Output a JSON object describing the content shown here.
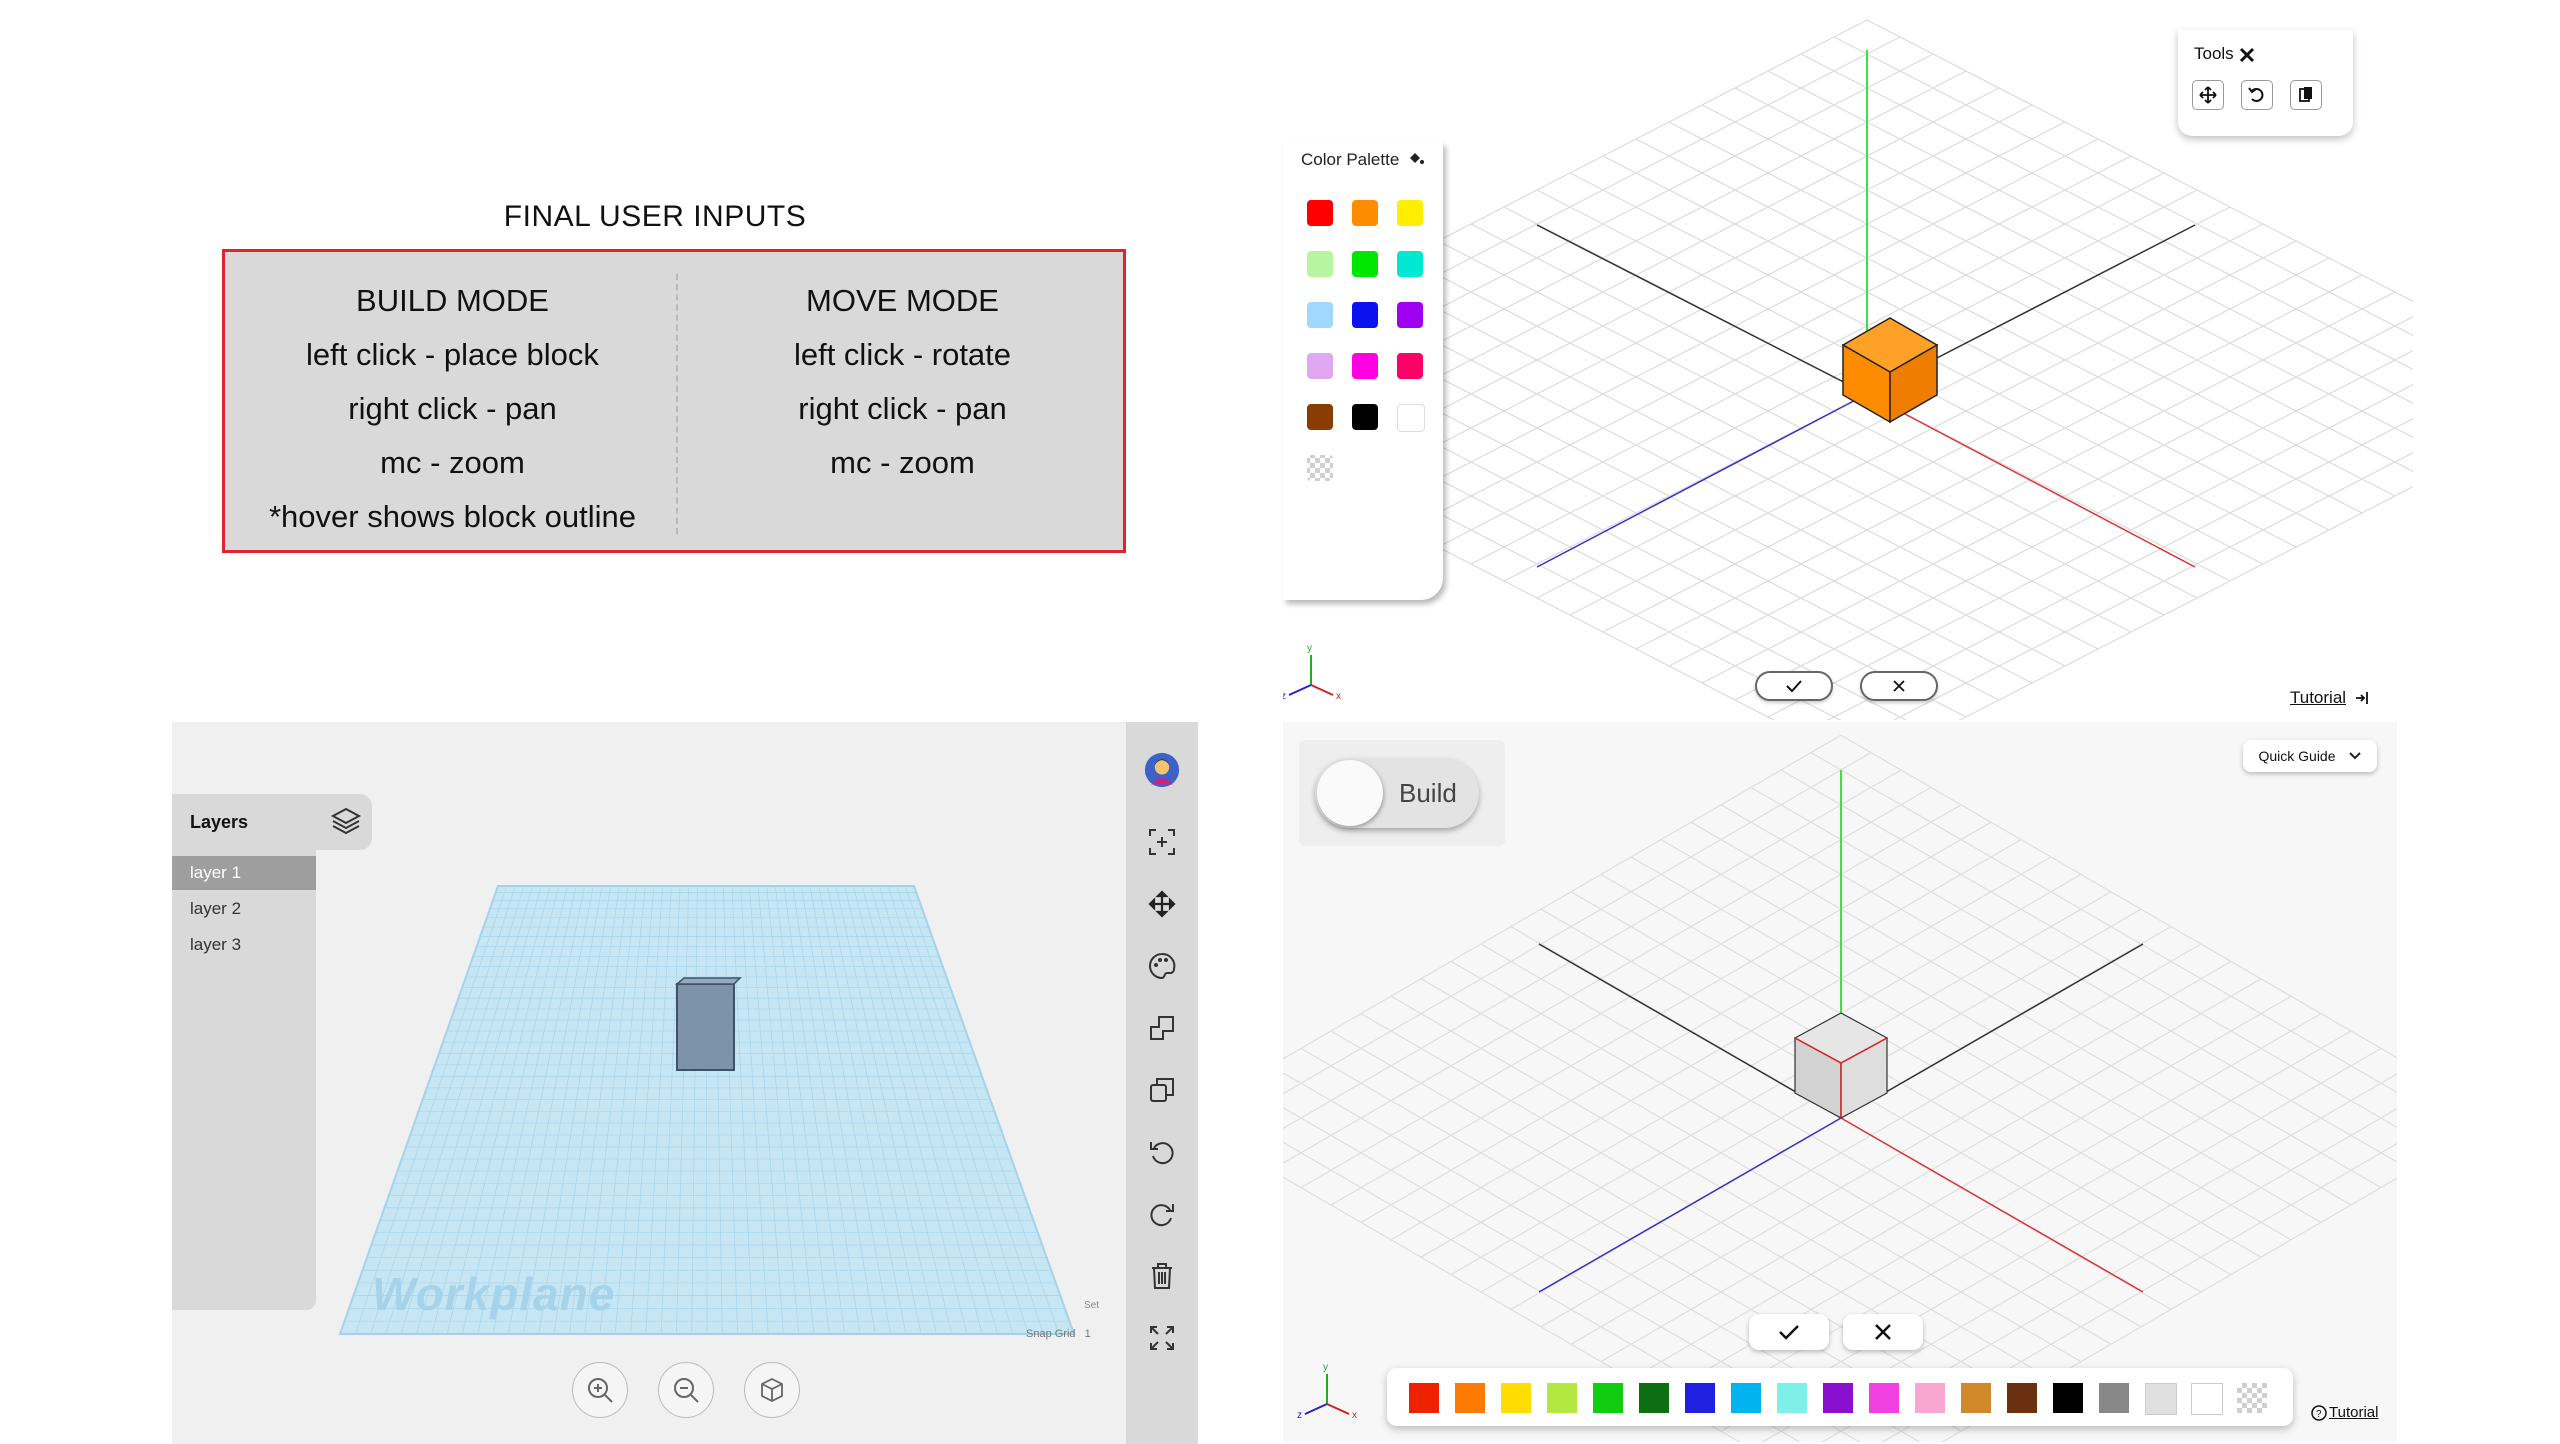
{
  "inputs": {
    "title": "FINAL USER INPUTS",
    "build_mode": {
      "heading": "BUILD MODE",
      "lines": [
        "left click - place block",
        "right click - pan",
        "mc - zoom",
        "*hover shows block outline"
      ]
    },
    "move_mode": {
      "heading": "MOVE MODE",
      "lines": [
        "left click - rotate",
        "right click - pan",
        "mc - zoom"
      ]
    }
  },
  "palette_scene": {
    "palette_title": "Color Palette",
    "palette_icon": "paint-bucket-icon",
    "swatches": [
      "#ff0000",
      "#ff8c00",
      "#ffee00",
      "#b8f5a0",
      "#00e600",
      "#00e8d0",
      "#a0d8ff",
      "#0a12f0",
      "#a000f0",
      "#e0a8f0",
      "#ff00e0",
      "#ff0066",
      "#8a3d00",
      "#000000",
      "#ffffff",
      "transparent"
    ],
    "tools_title": "Tools",
    "tools_icon": "crossed-tools-icon",
    "tools": [
      "move-icon",
      "rotate-icon",
      "copy-icon"
    ],
    "confirm_icon": "check-icon",
    "cancel_icon": "close-icon",
    "tutorial_label": "Tutorial",
    "tutorial_icon": "exit-icon",
    "axes_labels": {
      "y": "y",
      "z": "z",
      "x": "x"
    },
    "cube_color": "#ff8c00"
  },
  "editor": {
    "layers_title": "Layers",
    "layers_icon": "layers-stack-icon",
    "layers": [
      "layer 1",
      "layer 2",
      "layer 3"
    ],
    "active_layer": "layer 1",
    "workplane_label": "Workplane",
    "snap_grid_label": "Snap Grid",
    "snap_grid_value": "1",
    "settings_label_partial": "Set",
    "toolbar": [
      "avatar",
      "add-frame-icon",
      "move-icon",
      "palette-icon",
      "group-icon",
      "duplicate-icon",
      "undo-icon",
      "redo-icon",
      "trash-icon",
      "fullscreen-icon"
    ],
    "zoom_buttons": [
      "zoom-in-icon",
      "zoom-out-icon",
      "home-view-icon"
    ]
  },
  "build_scene": {
    "toggle_label": "Build",
    "quick_guide_label": "Quick Guide",
    "tutorial_label": "Tutorial",
    "colors": [
      "#ee2200",
      "#ff7a00",
      "#ffdd00",
      "#b2e840",
      "#12cc12",
      "#0e6e12",
      "#2020e0",
      "#00b4f0",
      "#7ff0e8",
      "#8a10d0",
      "#f040e0",
      "#f8a8d0",
      "#d08828",
      "#6b3010",
      "#000000",
      "#888888",
      "#e0e0e0",
      "#ffffff",
      "transparent"
    ],
    "axes_labels": {
      "y": "y",
      "z": "z",
      "x": "x"
    }
  }
}
